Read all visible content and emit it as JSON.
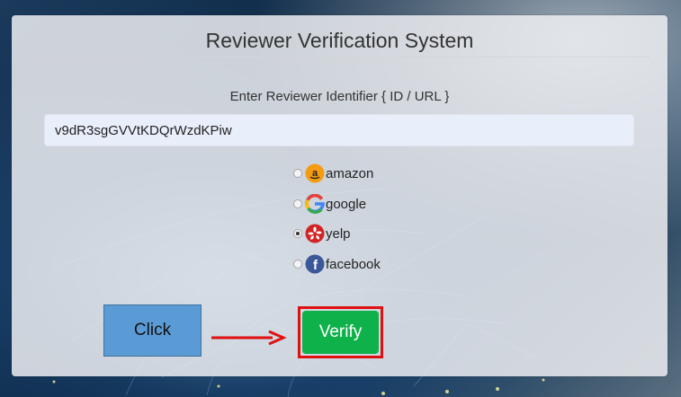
{
  "title": "Reviewer Verification System",
  "form": {
    "id_label": "Enter Reviewer Identifier { ID / URL }",
    "id_value": "v9dR3sgGVVtKDQrWzdKPiw"
  },
  "platforms": [
    {
      "label": "amazon",
      "icon": "amazon-icon",
      "checked": false
    },
    {
      "label": "google",
      "icon": "google-icon",
      "checked": false
    },
    {
      "label": "yelp",
      "icon": "yelp-icon",
      "checked": true
    },
    {
      "label": "facebook",
      "icon": "facebook-icon",
      "checked": false
    }
  ],
  "actions": {
    "click_label": "Click",
    "verify_label": "Verify"
  },
  "colors": {
    "verify_green": "#0fb14a",
    "highlight_red": "#e01010",
    "click_blue": "#5b9bd5",
    "amazon_orange": "#f39c12",
    "yelp_red": "#d32323",
    "facebook_blue": "#3b5998"
  }
}
